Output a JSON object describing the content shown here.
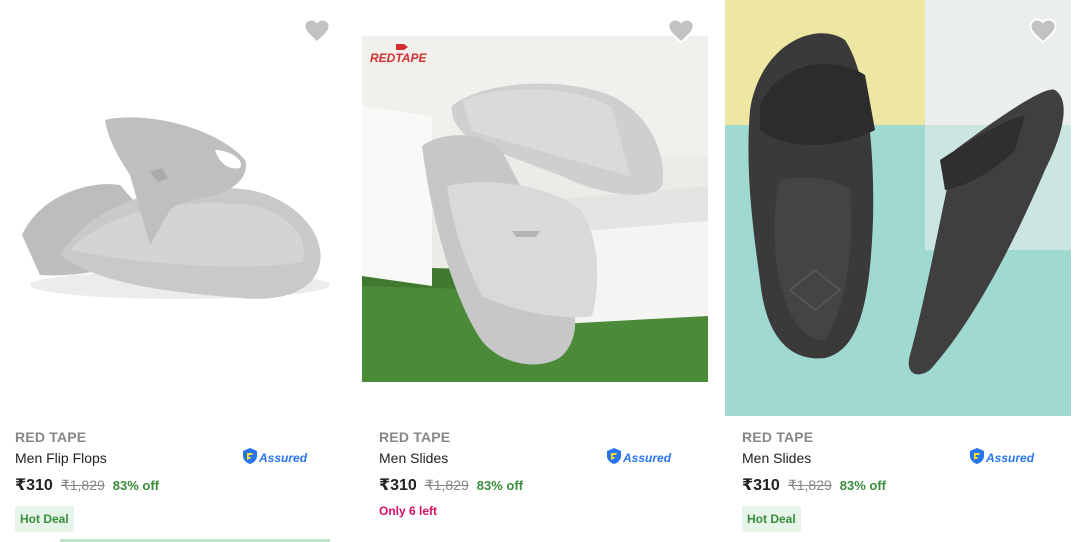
{
  "products": [
    {
      "brand": "RED TAPE",
      "title": "Men Flip Flops",
      "assured": "Assured",
      "price": "₹310",
      "mrp": "₹1,829",
      "discount": "83% off",
      "tag": "Hot Deal",
      "image_color": "#c8c8c8"
    },
    {
      "brand": "RED TAPE",
      "title": "Men Slides",
      "assured": "Assured",
      "price": "₹310",
      "mrp": "₹1,829",
      "discount": "83% off",
      "tag": "Only 6 left",
      "logo_text": "REDTAPE",
      "image_color": "#d6d6d6"
    },
    {
      "brand": "RED TAPE",
      "title": "Men Slides",
      "assured": "Assured",
      "price": "₹310",
      "mrp": "₹1,829",
      "discount": "83% off",
      "tag": "Hot Deal",
      "image_color": "#3a3a3a"
    }
  ],
  "icons": {
    "wishlist": "heart-icon",
    "assured": "shield-icon"
  },
  "colors": {
    "accent": "#2874f0",
    "discount": "#388e3c",
    "urgency": "#d70f64"
  }
}
